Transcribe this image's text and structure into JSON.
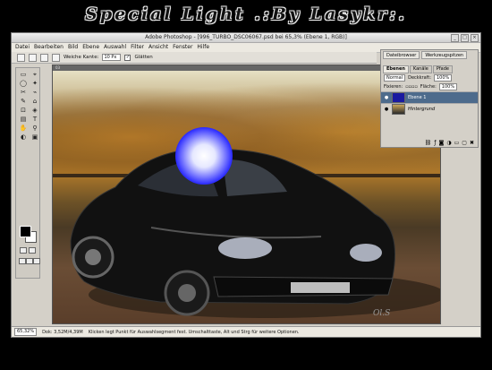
{
  "banner": {
    "title": "Special Light .:By Lasykr:."
  },
  "window": {
    "title": "Adobe Photoshop - [996_TURBO_DSC06067.psd bei 65,3% (Ebene 1, RGB)]",
    "controls": [
      "_",
      "□",
      "×"
    ]
  },
  "menu": [
    "Datei",
    "Bearbeiten",
    "Bild",
    "Ebene",
    "Auswahl",
    "Filter",
    "Ansicht",
    "Fenster",
    "Hilfe"
  ],
  "options": {
    "feather_label": "Weiche Kante:",
    "feather_value": "10 Px",
    "antialias_label": "Glätten"
  },
  "toolbox": {
    "tools": [
      "▭",
      "⌖",
      "◯",
      "✦",
      "✂",
      "⌁",
      "✎",
      "⌂",
      "⊡",
      "◈",
      "▤",
      "T",
      "✋",
      "⚲",
      "◐",
      "▣"
    ]
  },
  "document": {
    "tab": "03",
    "signature": "Ol.S"
  },
  "panel": {
    "top_tabs": [
      "Dateibrowser",
      "Werkzeugspitzen"
    ],
    "tabs": [
      "Ebenen",
      "Kanäle",
      "Pfade"
    ],
    "blend_mode": "Normal",
    "opacity_label": "Deckkraft:",
    "opacity_value": "100%",
    "lock_label": "Fixieren:",
    "fill_label": "Fläche:",
    "fill_value": "100%",
    "layers": [
      {
        "name": "Ebene 1",
        "selected": true
      },
      {
        "name": "Hintergrund",
        "selected": false
      }
    ]
  },
  "status": {
    "zoom": "65,32%",
    "doc": "Dok: 3,52M/4,39M",
    "hint": "Klicken legt Punkt für Auswahlsegment fest. Umschalttaste, Alt und Strg für weitere Optionen."
  },
  "colors": {
    "accent_selected_layer": "#4d6b8c",
    "glow": "#2a2aff"
  }
}
